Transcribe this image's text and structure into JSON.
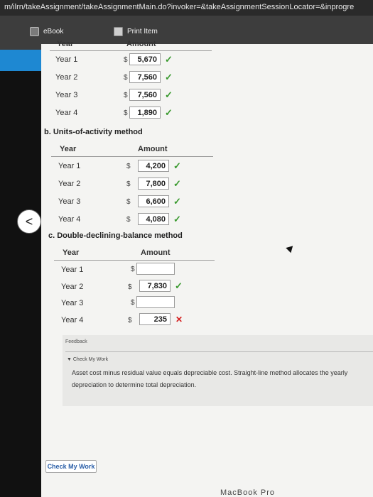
{
  "browser": {
    "url": "m/ilrn/takeAssignment/takeAssignmentMain.do?invoker=&takeAssignmentSessionLocator=&inprogre"
  },
  "toolbar": {
    "ebook_label": "eBook",
    "print_label": "Print Item"
  },
  "table_headers": {
    "year": "Year",
    "amount": "Amount"
  },
  "straight_line": {
    "rows": [
      {
        "year": "Year 1",
        "amount": "5,670"
      },
      {
        "year": "Year 2",
        "amount": "7,560"
      },
      {
        "year": "Year 3",
        "amount": "7,560"
      },
      {
        "year": "Year 4",
        "amount": "1,890"
      }
    ]
  },
  "units_of_activity": {
    "title": "b. Units-of-activity method",
    "rows": [
      {
        "year": "Year 1",
        "amount": "4,200"
      },
      {
        "year": "Year 2",
        "amount": "7,800"
      },
      {
        "year": "Year 3",
        "amount": "6,600"
      },
      {
        "year": "Year 4",
        "amount": "4,080"
      }
    ]
  },
  "double_declining": {
    "title": "c. Double-declining-balance method",
    "rows": [
      {
        "year": "Year 1",
        "amount": ""
      },
      {
        "year": "Year 2",
        "amount": "7,830"
      },
      {
        "year": "Year 3",
        "amount": ""
      },
      {
        "year": "Year 4",
        "amount": "235"
      }
    ]
  },
  "currency": "$",
  "marks": {
    "check": "✓",
    "cross": "✕"
  },
  "feedback": {
    "title": "Feedback",
    "check_label": "▼ Check My Work",
    "text": "Asset cost minus residual value equals depreciable cost. Straight-line method allocates the yearly depreciation to determine total depreciation."
  },
  "check_button": "Check My Work",
  "nav_glyph": "<",
  "bezel_text": "MacBook Pro"
}
